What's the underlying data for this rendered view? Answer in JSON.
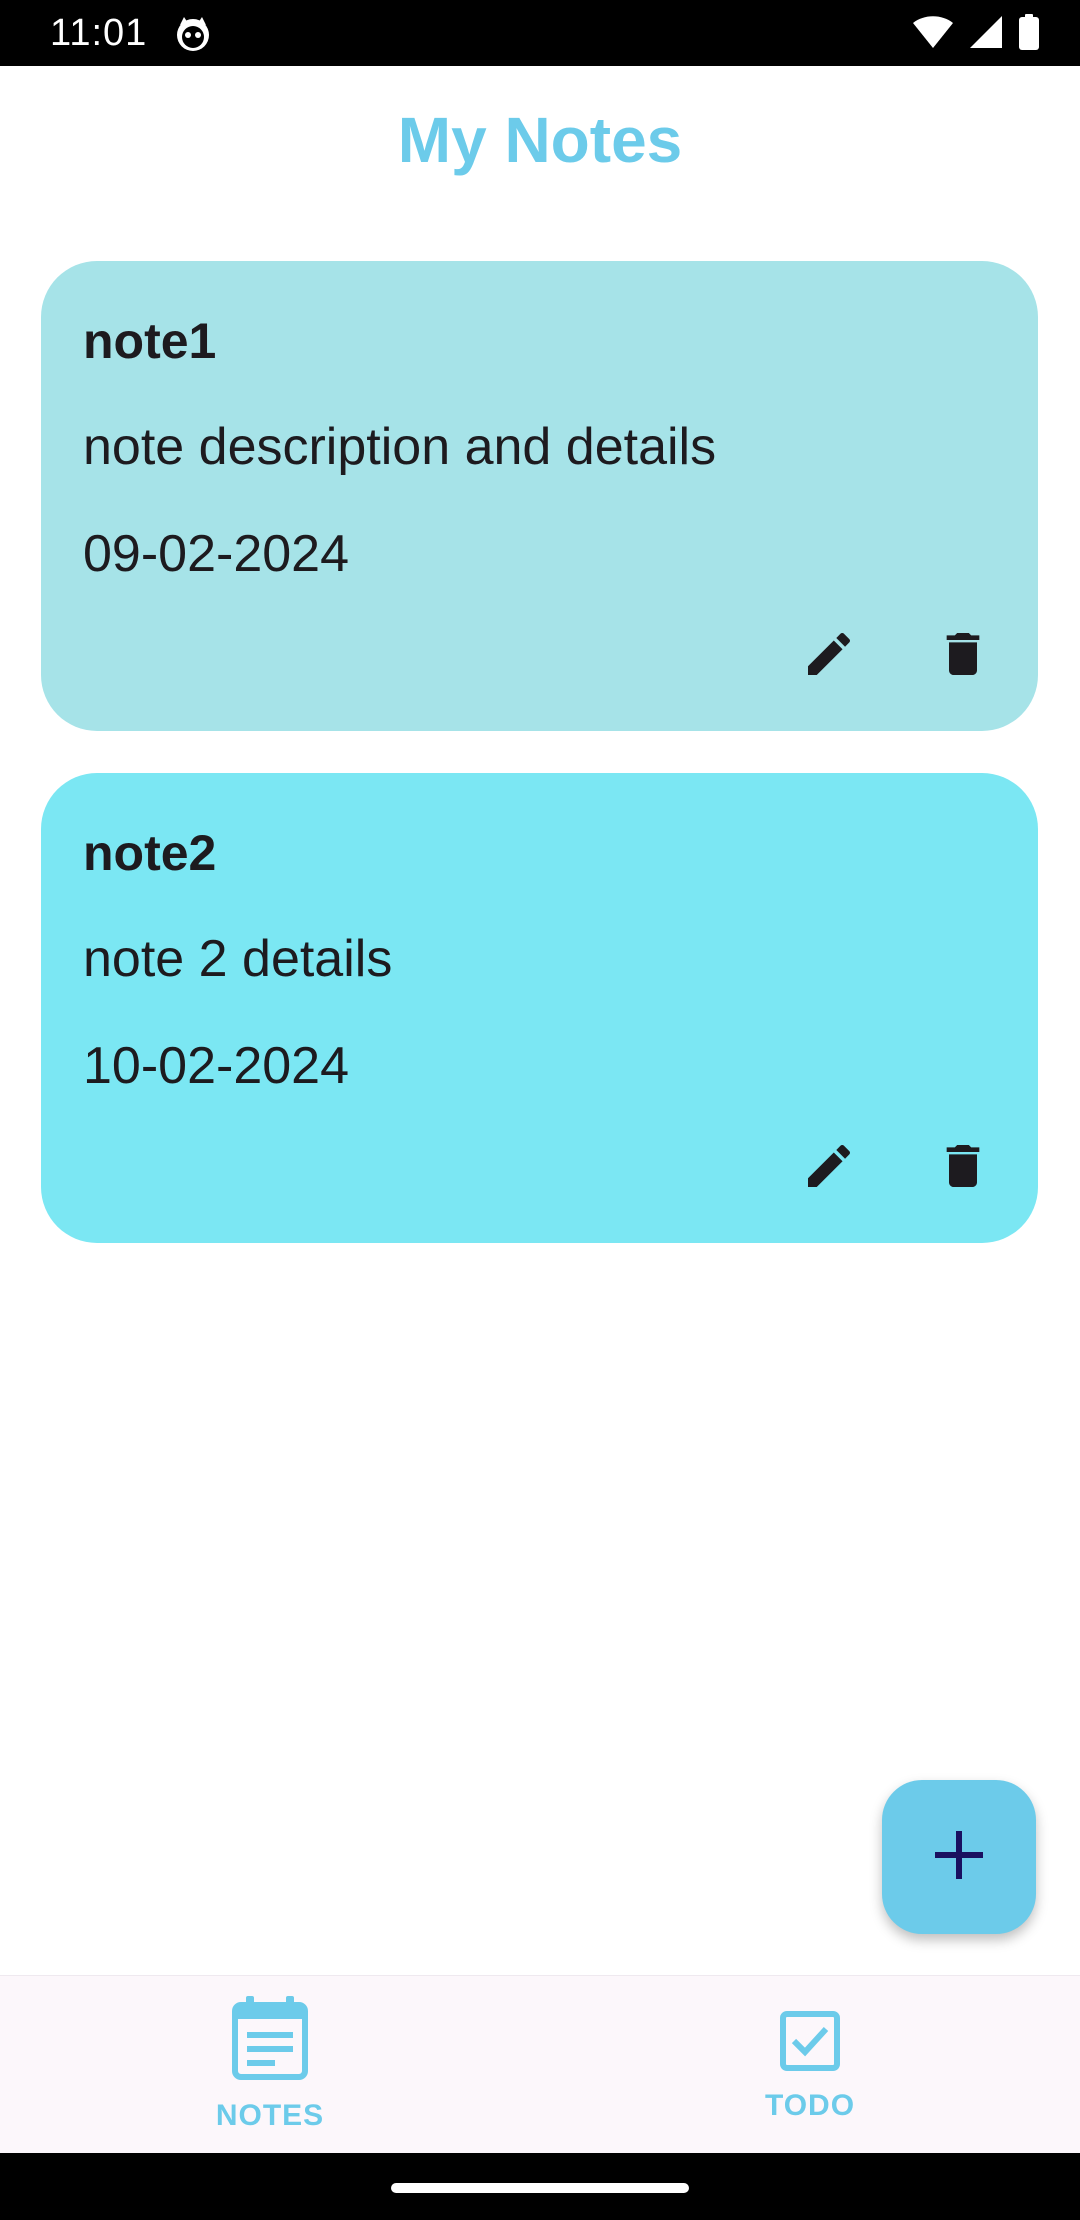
{
  "status_bar": {
    "time": "11:01",
    "app_icon": "cat-face-icon",
    "wifi_icon": "wifi-icon",
    "signal_icon": "signal-icon",
    "battery_icon": "battery-icon"
  },
  "header": {
    "title": "My Notes"
  },
  "notes": [
    {
      "title": "note1",
      "description": "note description and details",
      "date": "09-02-2024",
      "color": "#a6e3e8"
    },
    {
      "title": "note2",
      "description": "note 2 details",
      "date": "10-02-2024",
      "color": "#7be7f3"
    }
  ],
  "fab": {
    "icon": "plus-icon"
  },
  "bottom_nav": {
    "items": [
      {
        "label": "NOTES",
        "icon": "notes-calendar-icon",
        "selected": true
      },
      {
        "label": "TODO",
        "icon": "checkbox-icon",
        "selected": false
      }
    ]
  },
  "colors": {
    "accent": "#6ccbea",
    "text": "#1d1b1f",
    "nav_background": "#fcf7fb"
  }
}
